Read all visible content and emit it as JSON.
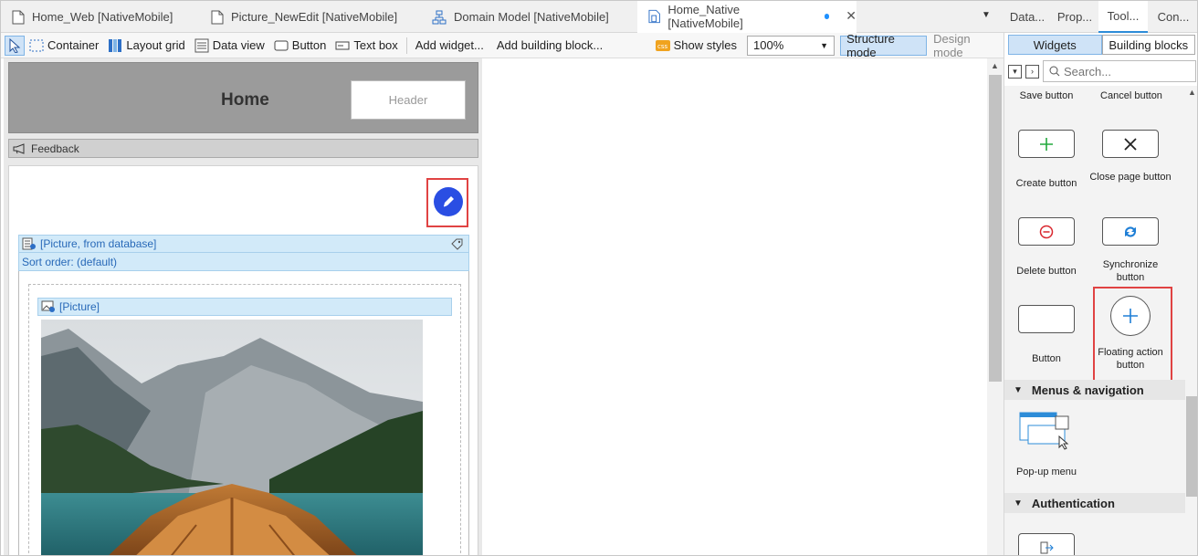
{
  "tabs": [
    {
      "label": "Home_Web [NativeMobile]",
      "icon": "page-icon"
    },
    {
      "label": "Picture_NewEdit [NativeMobile]",
      "icon": "page-icon"
    },
    {
      "label": "Domain Model [NativeMobile]",
      "icon": "domain-model-icon"
    },
    {
      "label": "Home_Native [NativeMobile]",
      "icon": "native-page-icon",
      "active": true,
      "unsaved": true
    }
  ],
  "right_tabs": [
    "Data...",
    "Prop...",
    "Tool...",
    "Con..."
  ],
  "toolbar": {
    "container": "Container",
    "layout_grid": "Layout grid",
    "data_view": "Data view",
    "button": "Button",
    "text_box": "Text box",
    "add_widget": "Add widget...",
    "add_building_block": "Add building block...",
    "show_styles": "Show styles",
    "zoom": "100%",
    "structure_mode": "Structure mode",
    "design_mode": "Design mode"
  },
  "canvas": {
    "page_title": "Home",
    "header_placeholder": "Header",
    "feedback": "Feedback",
    "data_view_header": "[Picture, from database]",
    "sort_order": "Sort order: (default)",
    "picture_header": "[Picture]"
  },
  "toolbox": {
    "widgets_tab": "Widgets",
    "building_blocks_tab": "Building blocks",
    "search_placeholder": "Search...",
    "items": {
      "save": "Save button",
      "cancel": "Cancel button",
      "create": "Create button",
      "close_page": "Close page button",
      "delete": "Delete button",
      "synchronize": "Synchronize button",
      "button": "Button",
      "fab": "Floating action button",
      "popup_menu": "Pop-up menu"
    },
    "categories": {
      "menus": "Menus & navigation",
      "authentication": "Authentication"
    }
  },
  "colors": {
    "fab_blue": "#2a4ee3",
    "highlight_red": "#e04343",
    "create_green": "#22a93d",
    "delete_red": "#d9272e",
    "sync_blue": "#1f7fd6"
  }
}
